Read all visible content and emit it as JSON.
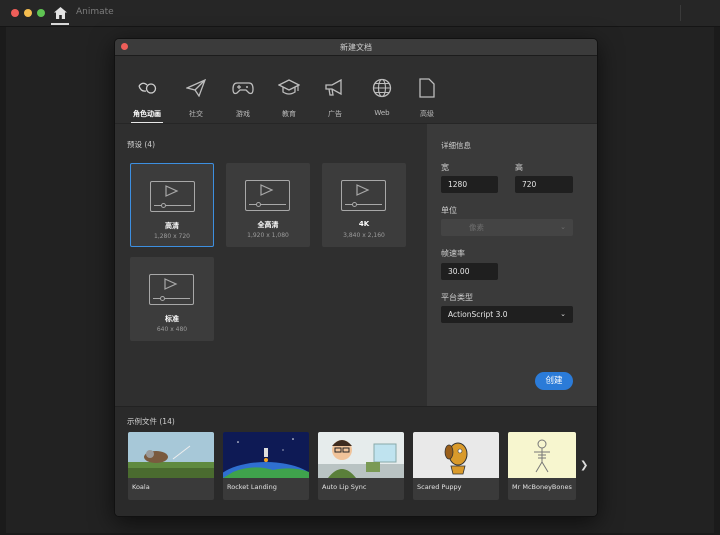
{
  "app": {
    "name": "Animate"
  },
  "dialog": {
    "title": "新建文档",
    "tabs": [
      {
        "label": "角色动画",
        "icon": "character-animation-icon"
      },
      {
        "label": "社交",
        "icon": "social-paper-plane-icon"
      },
      {
        "label": "游戏",
        "icon": "game-controller-icon"
      },
      {
        "label": "教育",
        "icon": "education-cap-icon"
      },
      {
        "label": "广告",
        "icon": "advertising-megaphone-icon"
      },
      {
        "label": "Web",
        "icon": "web-globe-icon"
      },
      {
        "label": "高级",
        "icon": "advanced-document-icon"
      }
    ],
    "presets": {
      "title": "预设 (4)",
      "items": [
        {
          "name": "高清",
          "size": "1,280 x 720"
        },
        {
          "name": "全高清",
          "size": "1,920 x 1,080"
        },
        {
          "name": "4K",
          "size": "3,840 x 2,160"
        },
        {
          "name": "标准",
          "size": "640 x 480"
        }
      ]
    },
    "details": {
      "title": "详细信息",
      "width_label": "宽",
      "width_value": "1280",
      "height_label": "高",
      "height_value": "720",
      "units_label": "单位",
      "units_value": "像素",
      "fps_label": "帧速率",
      "fps_value": "30.00",
      "platform_label": "平台类型",
      "platform_value": "ActionScript 3.0",
      "create_label": "创建"
    },
    "examples": {
      "title": "示例文件 (14)",
      "items": [
        {
          "name": "Koala"
        },
        {
          "name": "Rocket Landing"
        },
        {
          "name": "Auto Lip Sync"
        },
        {
          "name": "Scared Puppy"
        },
        {
          "name": "Mr McBoneyBones"
        }
      ]
    }
  },
  "colors": {
    "accent": "#2b7bd8",
    "selected_border": "#3d8fe0"
  }
}
